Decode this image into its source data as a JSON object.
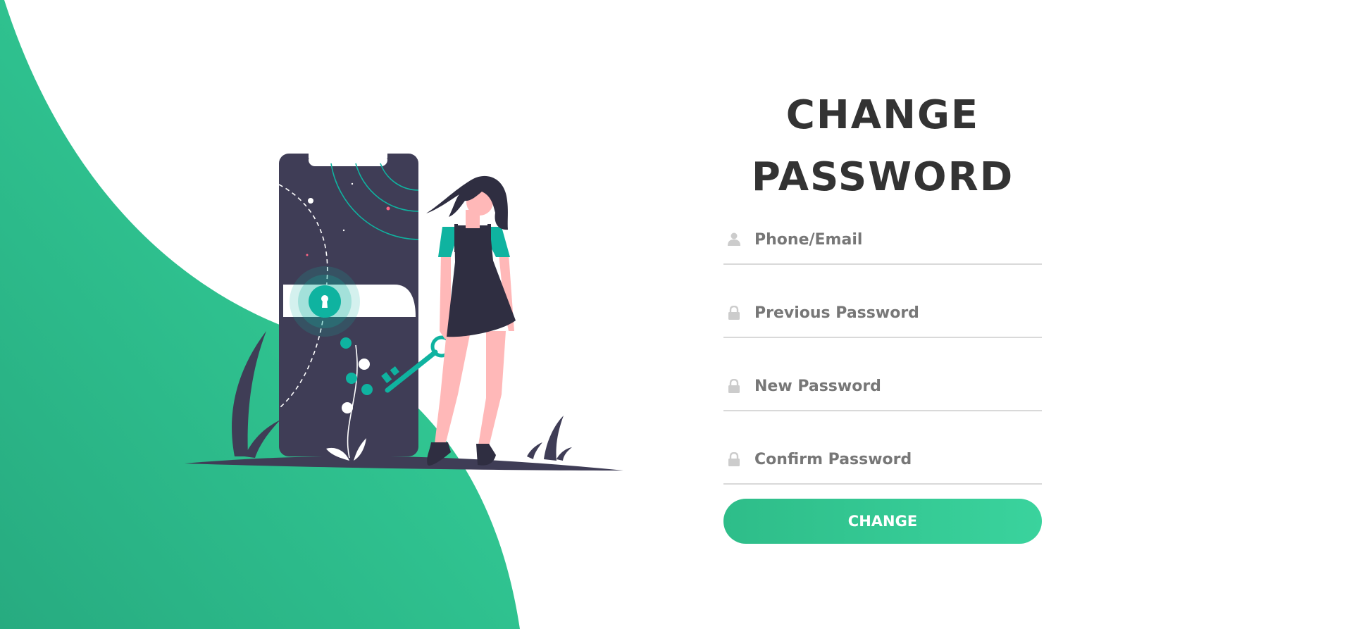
{
  "title": {
    "line1": "CHANGE",
    "line2": "PASSWORD"
  },
  "form": {
    "fields": [
      {
        "icon": "user-icon",
        "placeholder": "Phone/Email",
        "value": ""
      },
      {
        "icon": "lock-icon",
        "placeholder": "Previous Password",
        "value": ""
      },
      {
        "icon": "lock-icon",
        "placeholder": "New Password",
        "value": ""
      },
      {
        "icon": "lock-icon",
        "placeholder": "Confirm Password",
        "value": ""
      }
    ],
    "submit_label": "CHANGE"
  },
  "colors": {
    "accent": "#32d296",
    "accent_dark": "#2ab383",
    "illustration_dark": "#3f3d56",
    "teal": "#0fb3a0",
    "skin": "#ffb8b8",
    "title_text": "#333333",
    "placeholder_text": "#777777",
    "icon_gray": "#cccccc",
    "underline": "#d9d9d9"
  },
  "illustration": {
    "name": "phone-lock-with-woman-holding-key"
  }
}
